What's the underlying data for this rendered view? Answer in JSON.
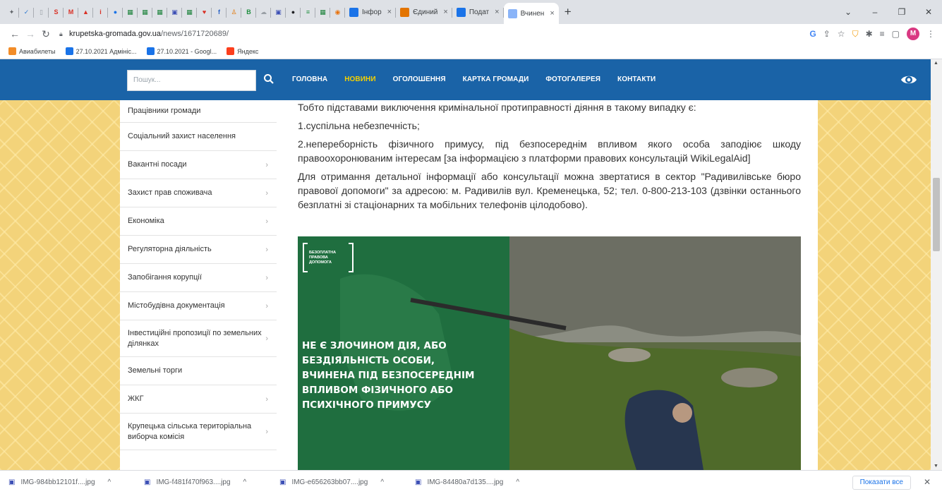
{
  "browser": {
    "mini_tabs": [
      {
        "icon": "star-icon",
        "glyph": "✦",
        "color": "#5f6368"
      },
      {
        "icon": "blue-tab-icon",
        "glyph": "✓",
        "color": "#2f7ad0"
      },
      {
        "icon": "doc-tab-icon",
        "glyph": "▯",
        "color": "#9aa0a6"
      },
      {
        "icon": "s-tab-icon",
        "glyph": "S",
        "color": "#d93025"
      },
      {
        "icon": "gmail-icon",
        "glyph": "M",
        "color": "#d93025"
      },
      {
        "icon": "drive-icon",
        "glyph": "▲",
        "color": "#d93025"
      },
      {
        "icon": "info-tab-icon",
        "glyph": "i",
        "color": "#d93025"
      },
      {
        "icon": "circle-tab-icon",
        "glyph": "●",
        "color": "#1a73e8"
      },
      {
        "icon": "table-tab-icon",
        "glyph": "▦",
        "color": "#188038"
      },
      {
        "icon": "table-tab-icon",
        "glyph": "▦",
        "color": "#188038"
      },
      {
        "icon": "table-tab-icon",
        "glyph": "▦",
        "color": "#188038"
      },
      {
        "icon": "blue-square-icon",
        "glyph": "▣",
        "color": "#3c4fb5"
      },
      {
        "icon": "table-tab-icon",
        "glyph": "▦",
        "color": "#188038"
      },
      {
        "icon": "heart-tab-icon",
        "glyph": "♥",
        "color": "#d93025"
      },
      {
        "icon": "blue-f-icon",
        "glyph": "f",
        "color": "#2c64c6"
      },
      {
        "icon": "person-tab-icon",
        "glyph": "♙",
        "color": "#e37400"
      },
      {
        "icon": "green-b-icon",
        "glyph": "B",
        "color": "#1e8e3e"
      },
      {
        "icon": "cloud-tab-icon",
        "glyph": "☁",
        "color": "#9aa0a6"
      },
      {
        "icon": "blue-square-icon",
        "glyph": "▣",
        "color": "#3c4fb5"
      },
      {
        "icon": "github-icon",
        "glyph": "●",
        "color": "#202124"
      },
      {
        "icon": "green-cap-icon",
        "glyph": "≡",
        "color": "#1e8e3e"
      },
      {
        "icon": "table-tab-icon",
        "glyph": "▦",
        "color": "#188038"
      },
      {
        "icon": "orange-tab-icon",
        "glyph": "◉",
        "color": "#e8710a"
      }
    ],
    "text_tabs": [
      {
        "title": "Інфор",
        "icon": "docs-icon",
        "color": "#1a73e8",
        "active": false
      },
      {
        "title": "Єдиний",
        "icon": "person-tab-icon",
        "color": "#e37400",
        "active": false
      },
      {
        "title": "Подат",
        "icon": "cg-icon",
        "color": "#1a73e8",
        "active": false
      },
      {
        "title": "Вчинен",
        "icon": "page-icon",
        "color": "#8ab4f8",
        "active": true
      }
    ],
    "tab_close": "×",
    "new_tab": "+",
    "window_controls": [
      "⌄",
      "–",
      "❐",
      "✕"
    ],
    "url_host": "krupetska-gromada.gov.ua",
    "url_path": "/news/1671720689/",
    "bookmarks": [
      {
        "label": "Авиабилеты",
        "icon": "plane-icon",
        "color": "#f28c28"
      },
      {
        "label": "27.10.2021 Адмініс...",
        "icon": "sheets-icon",
        "color": "#1a73e8"
      },
      {
        "label": "27.10.2021 - Googl...",
        "icon": "sheets-icon",
        "color": "#1a73e8"
      },
      {
        "label": "Яндекс",
        "icon": "yandex-icon",
        "color": "#fc3f1d"
      }
    ],
    "profile_letter": "M"
  },
  "site": {
    "search_placeholder": "Пошук...",
    "menu": [
      {
        "label": "ГОЛОВНА",
        "active": false
      },
      {
        "label": "НОВИНИ",
        "active": true
      },
      {
        "label": "ОГОЛОШЕННЯ",
        "active": false
      },
      {
        "label": "КАРТКА ГРОМАДИ",
        "active": false
      },
      {
        "label": "ФОТОГАЛЕРЕЯ",
        "active": false
      },
      {
        "label": "КОНТАКТИ",
        "active": false
      }
    ],
    "sidebar": [
      {
        "label": "Працівники громади",
        "chevron": false
      },
      {
        "label": "Соціальний захист населення",
        "chevron": false
      },
      {
        "label": "Вакантні посади",
        "chevron": true
      },
      {
        "label": "Захист прав споживача",
        "chevron": true
      },
      {
        "label": "Економіка",
        "chevron": true
      },
      {
        "label": "Регуляторна діяльність",
        "chevron": true
      },
      {
        "label": "Запобігання корупції",
        "chevron": true
      },
      {
        "label": "Містобудівна документація",
        "chevron": true
      },
      {
        "label": "Інвестиційні пропозиції по земельних ділянках",
        "chevron": true
      },
      {
        "label": "Земельні торги",
        "chevron": false
      },
      {
        "label": "ЖКГ",
        "chevron": true
      },
      {
        "label": "Крупецька сільська територіальна виборча комісія",
        "chevron": true
      }
    ],
    "chevron": "›",
    "article": {
      "p1": "Тобто підставами виключення кримінальної протиправності діяння в такому випадку є:",
      "p2": "1.суспільна небезпечність;",
      "p3": "2.непереборність фізичного примусу, під безпосереднім впливом якого особа заподіює шкоду правоохоронюваним інтересам [за інформацією з платформи правових консультацій WikiLegalAid]",
      "p4": "Для отримання детальної інформації або консультації можна звертатися в сектор \"Радивилівське бюро правової допомоги\" за адресою: м. Радивилів вул. Кременецька, 52; тел. 0-800-213-103 (дзвінки останнього безплатні зі стаціонарних та мобільних телефонів цілодобово)."
    },
    "banner": {
      "logo_lines": [
        "БЕЗОПЛАТНА",
        "ПРАВОВА",
        "ДОПОМОГА"
      ],
      "headline": [
        "НЕ Є ЗЛОЧИНОМ ДІЯ, АБО",
        "БЕЗДІЯЛЬНІСТЬ ОСОБИ,",
        "ВЧИНЕНА ПІД БЕЗПОСЕРЕДНІМ",
        "ВПЛИВОМ ФІЗИЧНОГО АБО",
        "ПСИХІЧНОГО ПРИМУСУ"
      ]
    }
  },
  "downloads": {
    "items": [
      "IMG-984bb12101f....jpg",
      "IMG-f481f470f963....jpg",
      "IMG-e656263bb07....jpg",
      "IMG-84480a7d135....jpg"
    ],
    "show_all": "Показати все",
    "close": "✕"
  },
  "colors": {
    "nav_blue": "#1a63a7",
    "active_menu": "#f4d000",
    "banner_green": "#1f6e3f",
    "page_bg": "#f3d37a"
  }
}
